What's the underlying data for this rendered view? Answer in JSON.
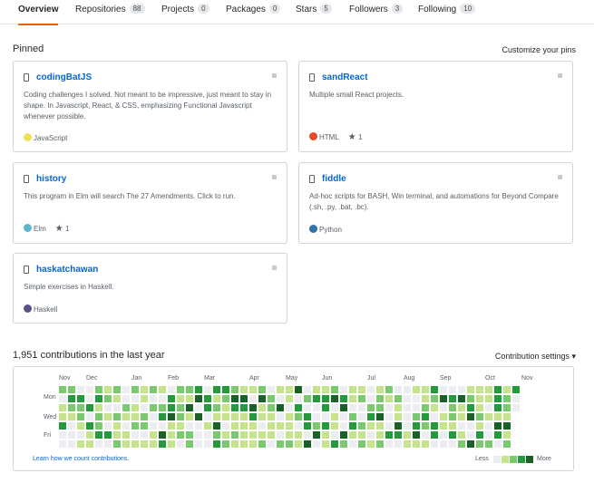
{
  "tabs": [
    {
      "label": "Overview"
    },
    {
      "label": "Repositories",
      "count": "88"
    },
    {
      "label": "Projects",
      "count": "0"
    },
    {
      "label": "Packages",
      "count": "0"
    },
    {
      "label": "Stars",
      "count": "5"
    },
    {
      "label": "Followers",
      "count": "3"
    },
    {
      "label": "Following",
      "count": "10"
    }
  ],
  "pinned": {
    "title": "Pinned",
    "customize": "Customize your pins",
    "cards": [
      {
        "name": "codingBatJS",
        "description": "Coding challenges I solved. Not meant to be impressive, just meant to stay in shape. In Javascript, React, & CSS, emphasizing Functional Javascript whenever possible.",
        "language": "JavaScript",
        "lang_color": "#f1e05a",
        "stars": ""
      },
      {
        "name": "sandReact",
        "description": "Multiple small React projects.",
        "language": "HTML",
        "lang_color": "#e34c26",
        "stars": "1"
      },
      {
        "name": "history",
        "description": "This program in Elm will search The 27 Amendments. Click to run.",
        "language": "Elm",
        "lang_color": "#60b5cc",
        "stars": "1"
      },
      {
        "name": "fiddle",
        "description": "Ad-hoc scripts for BASH, Win terminal, and automations for Beyond Compare (.sh, .py, .bat, .bc).",
        "language": "Python",
        "lang_color": "#3572a5",
        "stars": ""
      },
      {
        "name": "haskatchawan",
        "description": "Simple exercises in Haskell.",
        "language": "Haskell",
        "lang_color": "#5e5086",
        "stars": ""
      }
    ]
  },
  "contributions": {
    "title": "1,951 contributions in the last year",
    "settings": "Contribution settings ▾",
    "months": [
      "Nov",
      "Dec",
      "Jan",
      "Feb",
      "Mar",
      "Apr",
      "May",
      "Jun",
      "Jul",
      "Aug",
      "Sep",
      "Oct",
      "Nov"
    ],
    "days": [
      "Mon",
      "Wed",
      "Fri"
    ],
    "learn_link": "Learn how we count contributions.",
    "legend_less": "Less",
    "legend_more": "More",
    "colors": [
      "#ebedf0",
      "#c6e48b",
      "#7bc96f",
      "#239a3b",
      "#196127"
    ],
    "grid": "20113002321000032210100303112312230120103021021120021011201120111022012020011102304303341112122120214102234040000330100312142332110122431121143111110431112411012022111010401021101112403201102033041300240133031124011030340042110231012002120023101122411221000300211430000001110023411123201321033004011000322130041101212340041112132110100233314301221412300"
  }
}
